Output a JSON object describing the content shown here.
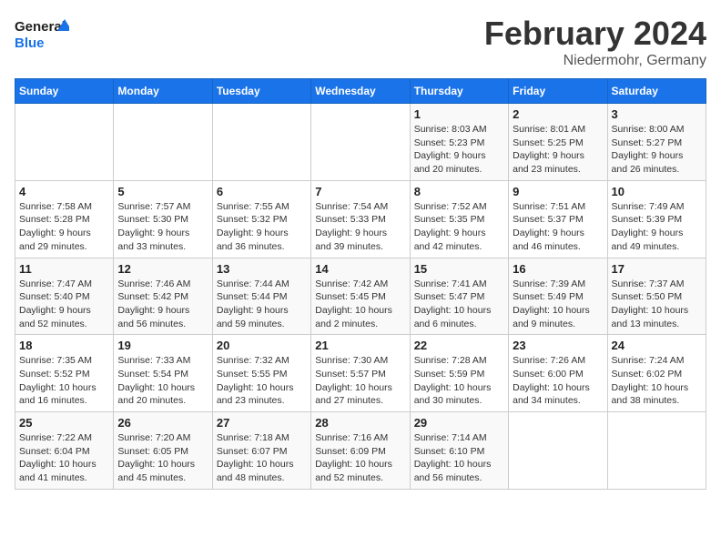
{
  "header": {
    "logo_line1": "General",
    "logo_line2": "Blue",
    "month": "February 2024",
    "location": "Niedermohr, Germany"
  },
  "weekdays": [
    "Sunday",
    "Monday",
    "Tuesday",
    "Wednesday",
    "Thursday",
    "Friday",
    "Saturday"
  ],
  "weeks": [
    [
      {
        "day": "",
        "info": ""
      },
      {
        "day": "",
        "info": ""
      },
      {
        "day": "",
        "info": ""
      },
      {
        "day": "",
        "info": ""
      },
      {
        "day": "1",
        "info": "Sunrise: 8:03 AM\nSunset: 5:23 PM\nDaylight: 9 hours\nand 20 minutes."
      },
      {
        "day": "2",
        "info": "Sunrise: 8:01 AM\nSunset: 5:25 PM\nDaylight: 9 hours\nand 23 minutes."
      },
      {
        "day": "3",
        "info": "Sunrise: 8:00 AM\nSunset: 5:27 PM\nDaylight: 9 hours\nand 26 minutes."
      }
    ],
    [
      {
        "day": "4",
        "info": "Sunrise: 7:58 AM\nSunset: 5:28 PM\nDaylight: 9 hours\nand 29 minutes."
      },
      {
        "day": "5",
        "info": "Sunrise: 7:57 AM\nSunset: 5:30 PM\nDaylight: 9 hours\nand 33 minutes."
      },
      {
        "day": "6",
        "info": "Sunrise: 7:55 AM\nSunset: 5:32 PM\nDaylight: 9 hours\nand 36 minutes."
      },
      {
        "day": "7",
        "info": "Sunrise: 7:54 AM\nSunset: 5:33 PM\nDaylight: 9 hours\nand 39 minutes."
      },
      {
        "day": "8",
        "info": "Sunrise: 7:52 AM\nSunset: 5:35 PM\nDaylight: 9 hours\nand 42 minutes."
      },
      {
        "day": "9",
        "info": "Sunrise: 7:51 AM\nSunset: 5:37 PM\nDaylight: 9 hours\nand 46 minutes."
      },
      {
        "day": "10",
        "info": "Sunrise: 7:49 AM\nSunset: 5:39 PM\nDaylight: 9 hours\nand 49 minutes."
      }
    ],
    [
      {
        "day": "11",
        "info": "Sunrise: 7:47 AM\nSunset: 5:40 PM\nDaylight: 9 hours\nand 52 minutes."
      },
      {
        "day": "12",
        "info": "Sunrise: 7:46 AM\nSunset: 5:42 PM\nDaylight: 9 hours\nand 56 minutes."
      },
      {
        "day": "13",
        "info": "Sunrise: 7:44 AM\nSunset: 5:44 PM\nDaylight: 9 hours\nand 59 minutes."
      },
      {
        "day": "14",
        "info": "Sunrise: 7:42 AM\nSunset: 5:45 PM\nDaylight: 10 hours\nand 2 minutes."
      },
      {
        "day": "15",
        "info": "Sunrise: 7:41 AM\nSunset: 5:47 PM\nDaylight: 10 hours\nand 6 minutes."
      },
      {
        "day": "16",
        "info": "Sunrise: 7:39 AM\nSunset: 5:49 PM\nDaylight: 10 hours\nand 9 minutes."
      },
      {
        "day": "17",
        "info": "Sunrise: 7:37 AM\nSunset: 5:50 PM\nDaylight: 10 hours\nand 13 minutes."
      }
    ],
    [
      {
        "day": "18",
        "info": "Sunrise: 7:35 AM\nSunset: 5:52 PM\nDaylight: 10 hours\nand 16 minutes."
      },
      {
        "day": "19",
        "info": "Sunrise: 7:33 AM\nSunset: 5:54 PM\nDaylight: 10 hours\nand 20 minutes."
      },
      {
        "day": "20",
        "info": "Sunrise: 7:32 AM\nSunset: 5:55 PM\nDaylight: 10 hours\nand 23 minutes."
      },
      {
        "day": "21",
        "info": "Sunrise: 7:30 AM\nSunset: 5:57 PM\nDaylight: 10 hours\nand 27 minutes."
      },
      {
        "day": "22",
        "info": "Sunrise: 7:28 AM\nSunset: 5:59 PM\nDaylight: 10 hours\nand 30 minutes."
      },
      {
        "day": "23",
        "info": "Sunrise: 7:26 AM\nSunset: 6:00 PM\nDaylight: 10 hours\nand 34 minutes."
      },
      {
        "day": "24",
        "info": "Sunrise: 7:24 AM\nSunset: 6:02 PM\nDaylight: 10 hours\nand 38 minutes."
      }
    ],
    [
      {
        "day": "25",
        "info": "Sunrise: 7:22 AM\nSunset: 6:04 PM\nDaylight: 10 hours\nand 41 minutes."
      },
      {
        "day": "26",
        "info": "Sunrise: 7:20 AM\nSunset: 6:05 PM\nDaylight: 10 hours\nand 45 minutes."
      },
      {
        "day": "27",
        "info": "Sunrise: 7:18 AM\nSunset: 6:07 PM\nDaylight: 10 hours\nand 48 minutes."
      },
      {
        "day": "28",
        "info": "Sunrise: 7:16 AM\nSunset: 6:09 PM\nDaylight: 10 hours\nand 52 minutes."
      },
      {
        "day": "29",
        "info": "Sunrise: 7:14 AM\nSunset: 6:10 PM\nDaylight: 10 hours\nand 56 minutes."
      },
      {
        "day": "",
        "info": ""
      },
      {
        "day": "",
        "info": ""
      }
    ]
  ]
}
